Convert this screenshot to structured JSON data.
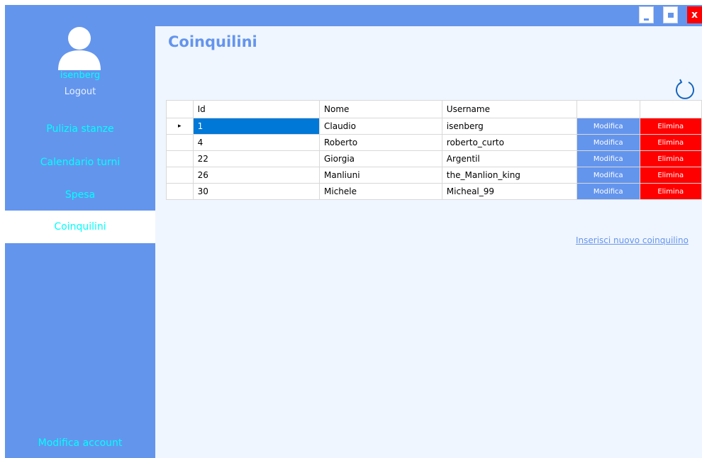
{
  "window": {
    "controls": {
      "minimize": "_",
      "maximize": "■",
      "close": "x"
    },
    "colors": {
      "accent": "#6495ed",
      "link": "#00ffff",
      "danger": "#ff0000",
      "selection": "#0078d7",
      "background": "#f0f6ff"
    }
  },
  "sidebar": {
    "avatar_icon": "user-avatar-icon",
    "username": "isenberg",
    "logout": "Logout",
    "items": [
      {
        "label": "Pulizia stanze",
        "active": false
      },
      {
        "label": "Calendario turni",
        "active": false
      },
      {
        "label": "Spesa",
        "active": false
      },
      {
        "label": "Coinquilini",
        "active": true
      }
    ],
    "footer": "Modifica account"
  },
  "main": {
    "title": "Coinquilini",
    "refresh_icon": "refresh-icon",
    "grid": {
      "columns": [
        "Id",
        "Nome",
        "Username",
        "",
        ""
      ],
      "current_row_marker": "▸",
      "edit_label": "Modifica",
      "delete_label": "Elimina",
      "rows": [
        {
          "id": "1",
          "nome": "Claudio",
          "username": "isenberg"
        },
        {
          "id": "4",
          "nome": "Roberto",
          "username": "roberto_curto"
        },
        {
          "id": "22",
          "nome": "Giorgia",
          "username": "Argentil"
        },
        {
          "id": "26",
          "nome": "Manliuni",
          "username": "the_Manlion_king"
        },
        {
          "id": "30",
          "nome": "Michele",
          "username": "Micheal_99"
        }
      ]
    },
    "add_link": "Inserisci nuovo coinquilino"
  }
}
